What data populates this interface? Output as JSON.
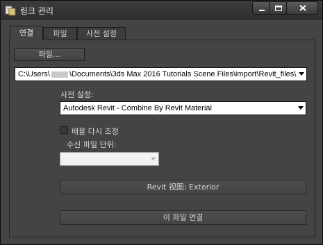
{
  "window": {
    "title": "링크 관리",
    "icon": "link-manager-icon",
    "controls": [
      "minimize-icon",
      "maximize-icon",
      "close-icon"
    ]
  },
  "tabs": [
    {
      "label": "연결",
      "active": true
    },
    {
      "label": "파일",
      "active": false
    },
    {
      "label": "사전 설정",
      "active": false
    }
  ],
  "attach": {
    "file_button": "파일...",
    "path_before": "C:\\Users\\",
    "path_after": "\\Documents\\3ds Max 2016 Tutorials Scene Files\\import\\Revit_files\\",
    "preset_label": "사전 설정:",
    "preset_value": "Autodesk Revit - Combine By Revit  Material",
    "rescale_label": "배율 다시 조정",
    "rescale_checked": false,
    "units_label": "수신 파일 단위:",
    "units_value": "",
    "revit_view_button": "Revit 视图: Exterior",
    "attach_button": "이 파일 연결"
  },
  "colors": {
    "window_bg": "#444444",
    "titlebar_bg": "#333333",
    "field_bg": "#ffffff"
  }
}
